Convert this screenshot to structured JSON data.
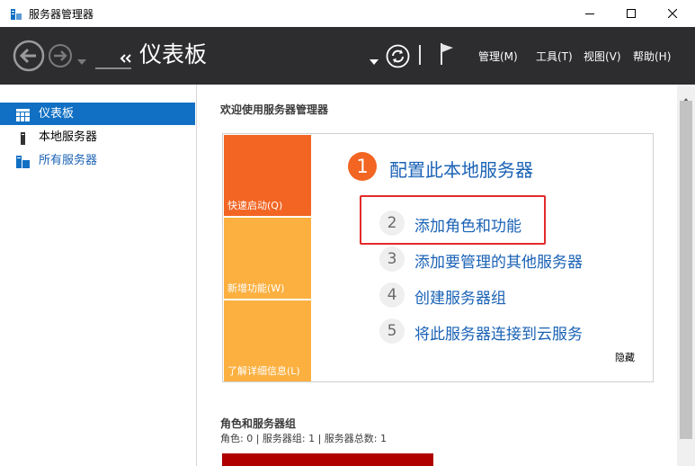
{
  "window": {
    "title": "服务器管理器",
    "controls": {
      "minimize": "minimize-icon",
      "maximize": "maximize-icon",
      "close": "close-icon"
    }
  },
  "header": {
    "breadcrumb_title": "仪表板",
    "menus": [
      "管理(M)",
      "工具(T)",
      "视图(V)",
      "帮助(H)"
    ],
    "icons": [
      "back-arrow-icon",
      "forward-arrow-icon",
      "refresh-icon",
      "flag-icon"
    ]
  },
  "sidebar": {
    "items": [
      {
        "label": "仪表板",
        "icon": "dashboard-icon",
        "selected": true
      },
      {
        "label": "本地服务器",
        "icon": "server-icon",
        "selected": false
      },
      {
        "label": "所有服务器",
        "icon": "servers-icon",
        "selected": false
      }
    ]
  },
  "main": {
    "welcome_title": "欢迎使用服务器管理器",
    "tiles": [
      {
        "label": "快速启动(Q)",
        "color": "#f26522"
      },
      {
        "label": "新增功能(W)",
        "color": "#fbb040"
      },
      {
        "label": "了解详细信息(L)",
        "color": "#fbb040"
      }
    ],
    "steps": [
      {
        "num": "1",
        "label": "配置此本地服务器"
      },
      {
        "num": "2",
        "label": "添加角色和功能"
      },
      {
        "num": "3",
        "label": "添加要管理的其他服务器"
      },
      {
        "num": "4",
        "label": "创建服务器组"
      },
      {
        "num": "5",
        "label": "将此服务器连接到云服务"
      }
    ],
    "hide_label": "隐藏",
    "roles_title": "角色和服务器组",
    "roles_stats": "角色: 0 | 服务器组: 1 | 服务器总数: 1"
  },
  "colors": {
    "header_bg": "#2d2d30",
    "accent": "#1170c4",
    "link": "#1a62b5",
    "tile_orange": "#f26522",
    "tile_amber": "#fbb040",
    "highlight": "#e32a2a",
    "status_red": "#b00000"
  }
}
